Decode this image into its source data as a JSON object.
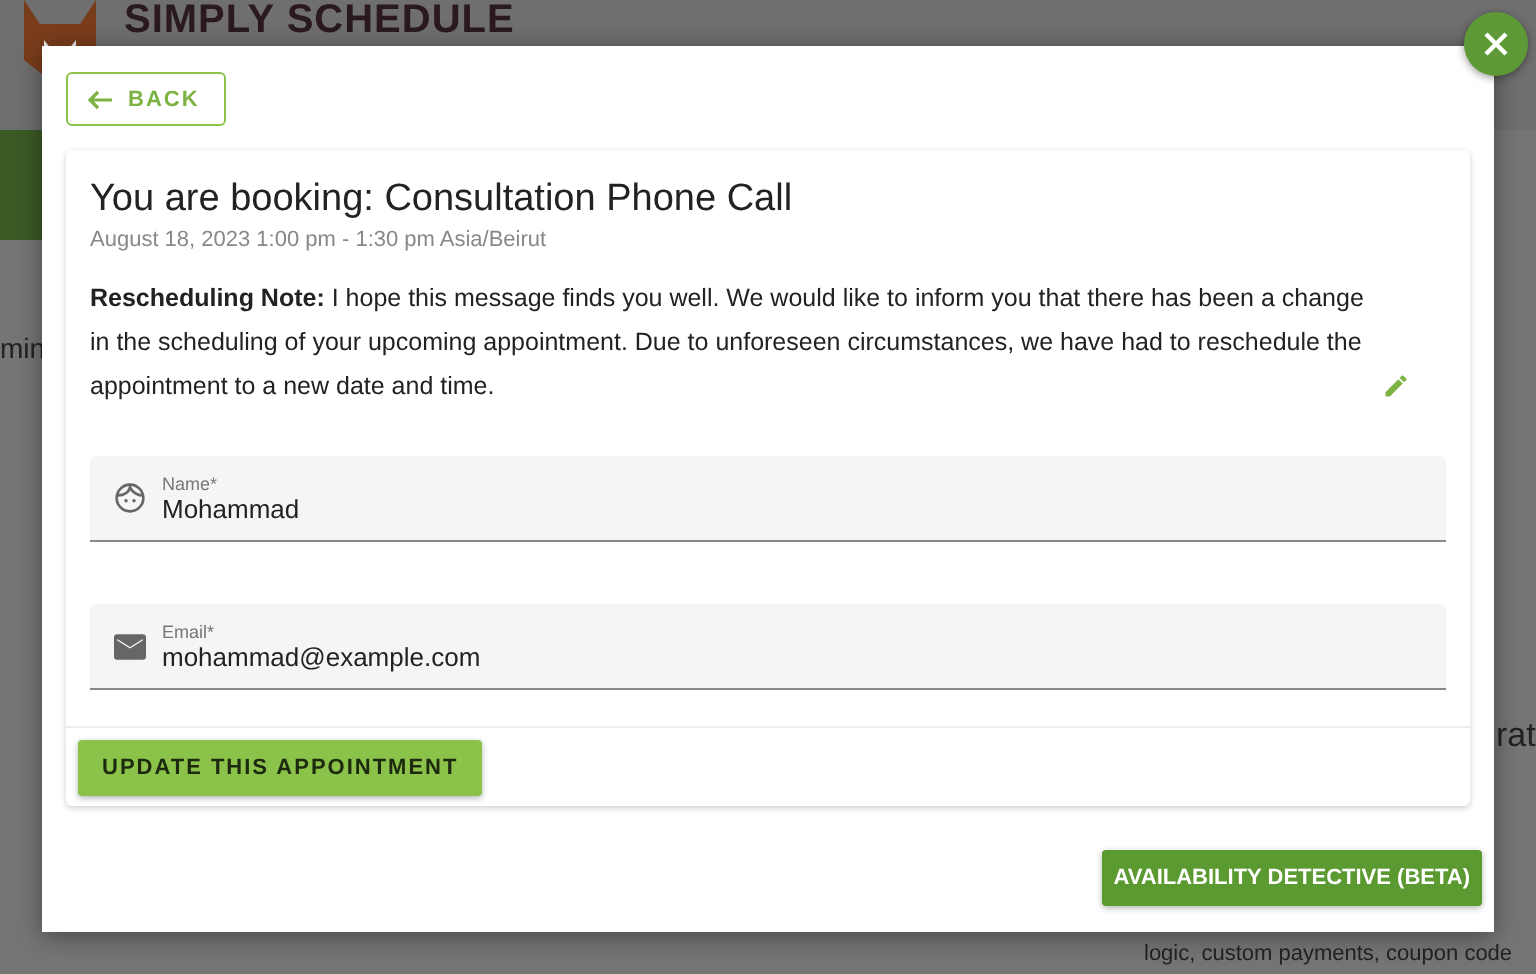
{
  "background": {
    "logo": "SIMPLY SCHEDULE",
    "left_fragment": "min",
    "right_heading": "rat",
    "right_line": "logic, custom payments, coupon code"
  },
  "modal": {
    "back": "BACK",
    "title": "You are booking: Consultation Phone Call",
    "datetime": "August 18, 2023 1:00 pm - 1:30 pm Asia/Beirut",
    "note_label": "Rescheduling Note:",
    "note": "I hope this message finds you well. We would like to inform you that there has been a change in the scheduling of your upcoming appointment. Due to unforeseen circumstances, we have had to reschedule the appointment to a new date and time.",
    "fields": [
      {
        "kind": "name",
        "label": "Name*",
        "value": "Mohammad"
      },
      {
        "kind": "email",
        "label": "Email*",
        "value": "mohammad@example.com"
      }
    ],
    "submit": "UPDATE THIS APPOINTMENT",
    "detective": "AVAILABILITY DETECTIVE (BETA)"
  }
}
